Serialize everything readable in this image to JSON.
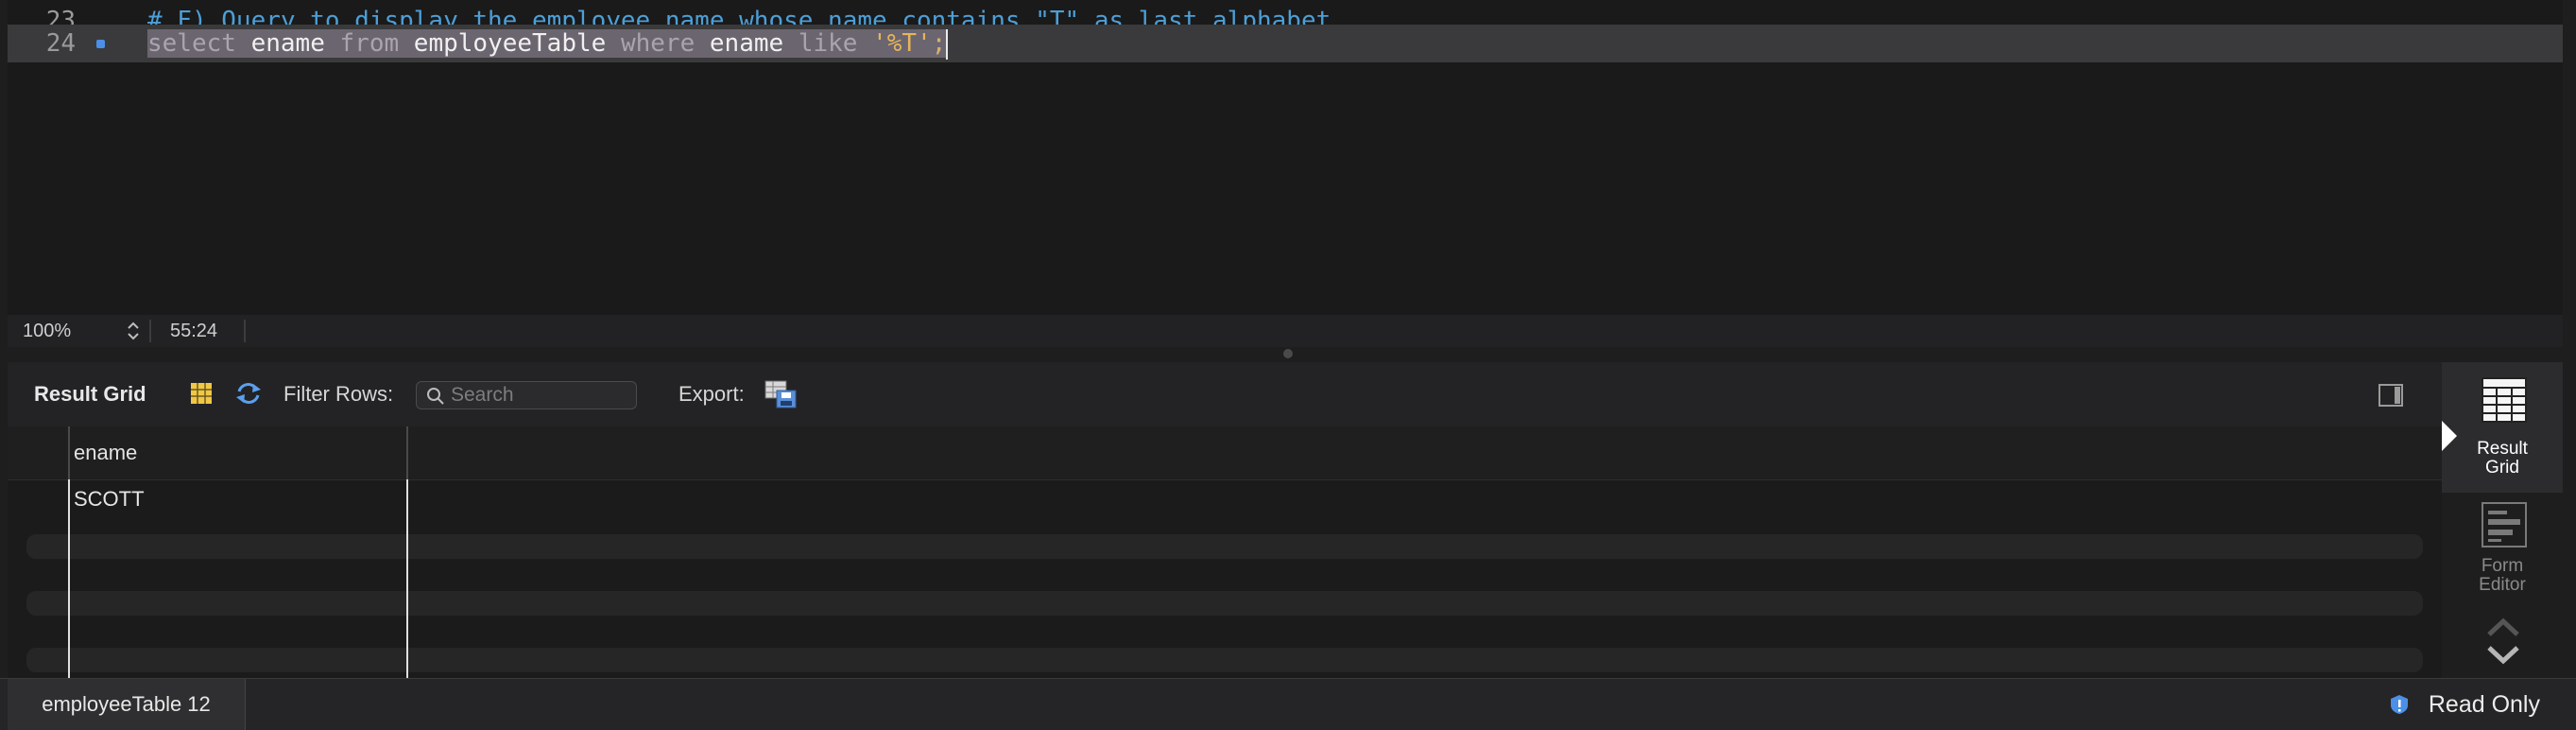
{
  "editor": {
    "lines": [
      {
        "number": "23",
        "text": "# F) Query to display the employee name whose name contains \"T\" as last alphabet"
      },
      {
        "number": "24",
        "tokens": {
          "kw1": "select",
          "col": "ename",
          "kw2": "from",
          "table": "employeeTable",
          "kw3": "where",
          "col2": "ename",
          "kw4": "like",
          "str": "'%T'",
          "end": ";"
        }
      }
    ]
  },
  "status": {
    "zoom": "100%",
    "position": "55:24"
  },
  "results_toolbar": {
    "title": "Result Grid",
    "filter_label": "Filter Rows:",
    "search_placeholder": "Search",
    "export_label": "Export:"
  },
  "grid": {
    "columns": [
      "ename"
    ],
    "rows": [
      [
        "SCOTT"
      ]
    ]
  },
  "sidebar": {
    "result_grid_label": [
      "Result",
      "Grid"
    ],
    "form_editor_label": [
      "Form",
      "Editor"
    ]
  },
  "bottom": {
    "tab_label": "employeeTable 12",
    "read_only": "Read Only"
  },
  "colors": {
    "comment": "#4d9fd6",
    "keyword": "#a9a4ae",
    "string": "#e6b45a",
    "accent": "#4c8fe6"
  }
}
